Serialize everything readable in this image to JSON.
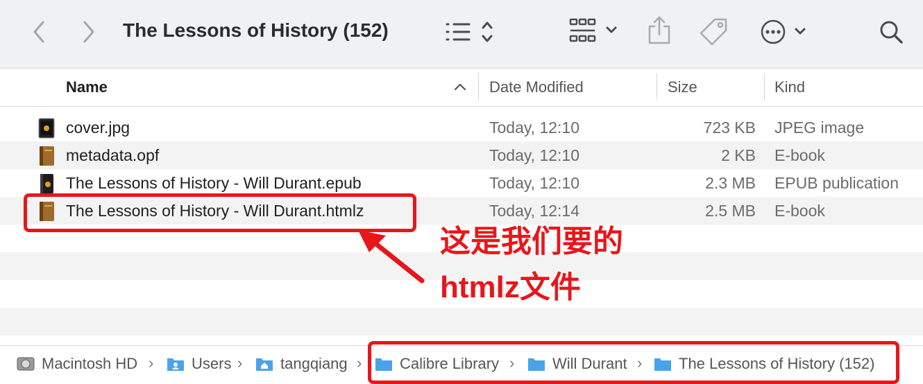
{
  "toolbar": {
    "title": "The Lessons of History (152)",
    "back_icon": "chevron-left-icon",
    "forward_icon": "chevron-right-icon",
    "view_icon": "list-view-icon",
    "group_icon": "grid-group-icon",
    "share_icon": "share-icon",
    "tag_icon": "tag-icon",
    "more_icon": "ellipsis-circle-icon",
    "search_icon": "search-icon"
  },
  "columns": {
    "name": "Name",
    "date": "Date Modified",
    "size": "Size",
    "kind": "Kind"
  },
  "files": [
    {
      "name": "cover.jpg",
      "date": "Today, 12:10",
      "size": "723 KB",
      "kind": "JPEG image",
      "icon": "jpeg-file-icon"
    },
    {
      "name": "metadata.opf",
      "date": "Today, 12:10",
      "size": "2 KB",
      "kind": "E-book",
      "icon": "ebook-file-icon"
    },
    {
      "name": "The Lessons of History - Will Durant.epub",
      "date": "Today, 12:10",
      "size": "2.3 MB",
      "kind": "EPUB publication",
      "icon": "epub-file-icon"
    },
    {
      "name": "The Lessons of History - Will Durant.htmlz",
      "date": "Today, 12:14",
      "size": "2.5 MB",
      "kind": "E-book",
      "icon": "ebook-file-icon"
    }
  ],
  "annotation": {
    "line1": "这是我们要的",
    "line2": "htmlz文件"
  },
  "pathbar": [
    {
      "label": "Macintosh HD",
      "icon": "hard-drive-icon"
    },
    {
      "label": "Users",
      "icon": "users-folder-icon"
    },
    {
      "label": "tangqiang",
      "icon": "home-folder-icon"
    },
    {
      "label": "Calibre Library",
      "icon": "folder-icon"
    },
    {
      "label": "Will Durant",
      "icon": "folder-icon"
    },
    {
      "label": "The Lessons of History (152)",
      "icon": "folder-icon"
    }
  ],
  "colors": {
    "toolbar_bg": "#eff1f3",
    "row_alt": "#f3f3f3",
    "highlight": "#e8161b",
    "folder": "#4aa3e8"
  }
}
